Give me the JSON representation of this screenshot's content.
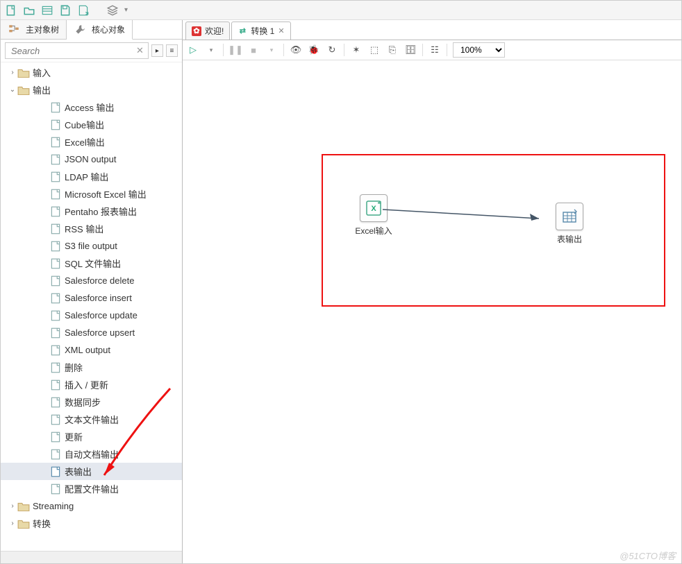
{
  "toolbar_icons": [
    "new-icon",
    "open-icon",
    "explore-icon",
    "save-icon",
    "saveas-icon",
    "layers-icon"
  ],
  "side_tabs": [
    {
      "label": "主对象树",
      "icon": "tree-icon"
    },
    {
      "label": "核心对象",
      "icon": "tool-icon",
      "active": true
    }
  ],
  "search": {
    "placeholder": "Search"
  },
  "tree": {
    "input_folder": "输入",
    "output_folder": "输出",
    "output_items": [
      "Access 输出",
      "Cube输出",
      "Excel输出",
      "JSON output",
      "LDAP 输出",
      "Microsoft Excel 输出",
      "Pentaho 报表输出",
      "RSS 输出",
      "S3 file output",
      "SQL 文件输出",
      "Salesforce delete",
      "Salesforce insert",
      "Salesforce update",
      "Salesforce upsert",
      "XML output",
      "删除",
      "插入 / 更新",
      "数据同步",
      "文本文件输出",
      "更新",
      "自动文档输出",
      "表输出",
      "配置文件输出"
    ],
    "selected_index": 21,
    "streaming": "Streaming",
    "transform": "转换"
  },
  "canvas_tabs": [
    {
      "label": "欢迎!",
      "icon": "welcome-icon",
      "color": "#d33"
    },
    {
      "label": "转换 1",
      "icon": "trans-icon",
      "color": "#3a8",
      "active": true
    }
  ],
  "canvas_toolbar": {
    "zoom": "100%"
  },
  "canvas_steps": {
    "step1": "Excel输入",
    "step2": "表输出"
  },
  "watermark": "@51CTO博客"
}
